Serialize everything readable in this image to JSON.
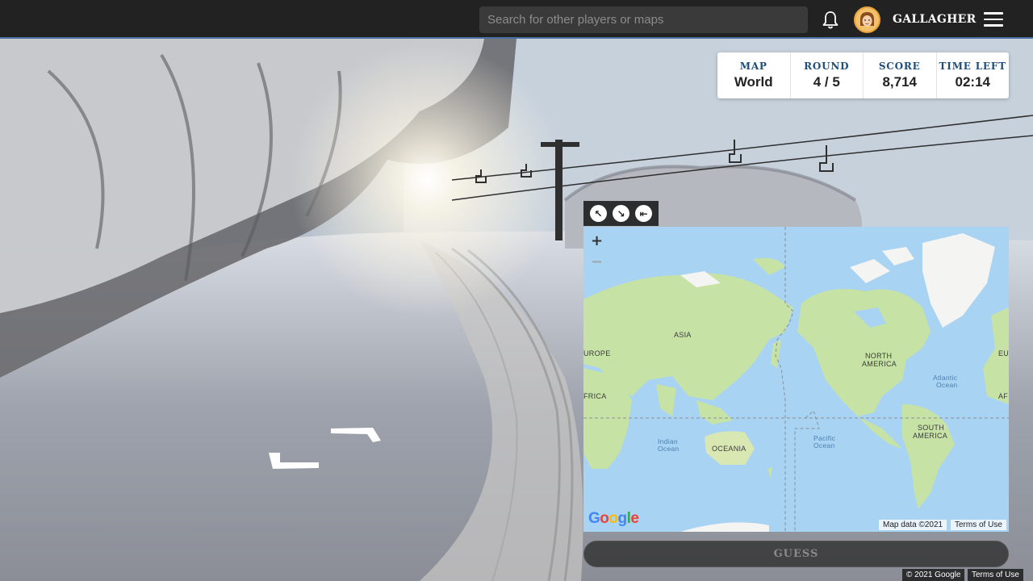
{
  "topbar": {
    "search_placeholder": "Search for other players or maps",
    "username": "GALLAGHER"
  },
  "status": {
    "map_label": "MAP",
    "map_value": "World",
    "round_label": "ROUND",
    "round_value": "4 / 5",
    "score_label": "SCORE",
    "score_value": "8,714",
    "time_label": "TIME LEFT",
    "time_value": "02:14"
  },
  "map": {
    "zoom_in": "+",
    "zoom_out": "−",
    "labels": {
      "asia": "ASIA",
      "europe": "UROPE",
      "africa": "FRICA",
      "north_america_1": "NORTH",
      "north_america_2": "AMERICA",
      "south_america_1": "SOUTH",
      "south_america_2": "AMERICA",
      "oceania": "OCEANIA",
      "atlantic_1": "Atlantic",
      "atlantic_2": "Ocean",
      "indian_1": "Indian",
      "indian_2": "Ocean",
      "pacific_1": "Pacific",
      "pacific_2": "Ocean",
      "eu_right": "EU",
      "af_right": "AF"
    },
    "map_data": "Map data ©2021",
    "terms": "Terms of Use"
  },
  "guess_label": "GUESS",
  "footer": {
    "copyright": "© 2021 Google",
    "terms": "Terms of Use"
  },
  "colors": {
    "topbar": "#222222",
    "status_label": "#1f4e79",
    "map_water": "#a9d3f2",
    "map_land": "#c6e3a5"
  }
}
